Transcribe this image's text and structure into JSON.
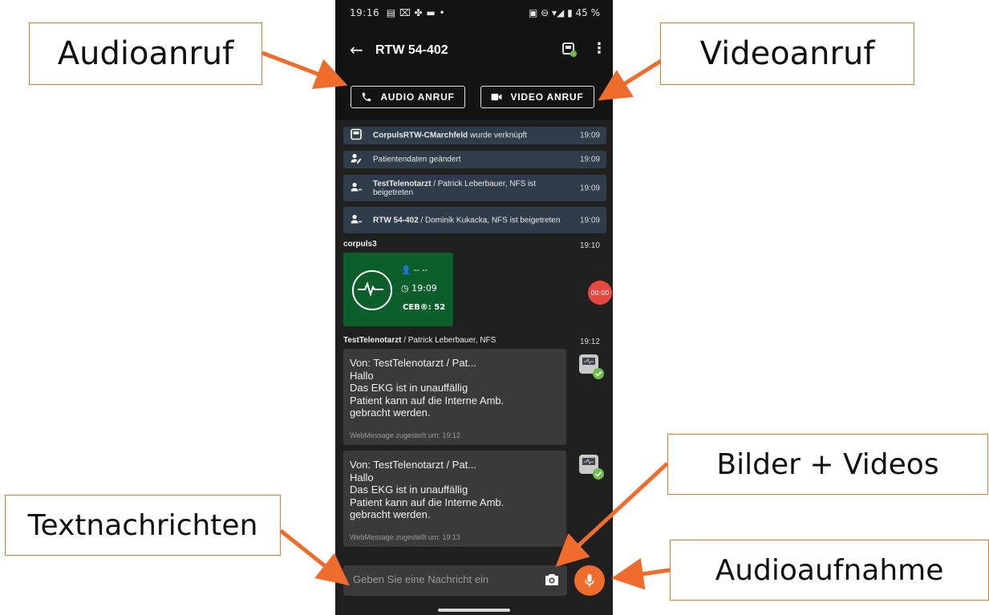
{
  "status_bar": {
    "time": "19:16",
    "battery": "45 %"
  },
  "header": {
    "title": "RTW 54-402"
  },
  "call_buttons": {
    "audio_label": "AUDIO ANRUF",
    "video_label": "VIDEO ANRUF"
  },
  "system_messages": [
    {
      "bold": "CorpulsRTW-CMarchfeld",
      "text": " wurde verknüpft",
      "time": "19:09"
    },
    {
      "bold": "",
      "text": "Patientendaten geändert",
      "time": "19:09"
    },
    {
      "bold": "TestTelenotarzt",
      "text": " / Patrick Leberbauer, NFS ist beigetreten",
      "time": "19:09"
    },
    {
      "bold": "RTW 54-402",
      "text": " / Dominik Kukacka, NFS ist beigetreten",
      "time": "19:09"
    }
  ],
  "ecg_message": {
    "sender": "corpuls3",
    "time": "19:10",
    "patient": "-- --",
    "clock": "19:09",
    "ceb": "CEB®: 52"
  },
  "recording_badge": "00:00",
  "text_messages_header": {
    "sender_bold": "TestTelenotarzt",
    "sender_rest": " / Patrick Leberbauer, NFS",
    "time": "19:12"
  },
  "text_messages": [
    {
      "body": "Von: TestTelenotarzt / Pat...\nHallo\nDas EKG ist in unauffällig\nPatient kann auf die Interne Amb.\ngebracht werden.",
      "footer": "WebMessage zugestellt um: 19:12"
    },
    {
      "body": "Von: TestTelenotarzt / Pat...\nHallo\nDas EKG ist in unauffällig\nPatient kann auf die Interne Amb.\ngebracht werden.",
      "footer": "WebMessage zugestellt um: 19:13"
    }
  ],
  "input": {
    "placeholder": "Geben Sie eine Nachricht ein"
  },
  "callouts": {
    "audio_call": "Audioanruf",
    "video_call": "Videoanruf",
    "media": "Bilder + Videos",
    "text_messages": "Textnachrichten",
    "audio_recording": "Audioaufnahme"
  },
  "colors": {
    "accent": "#ef6c2c",
    "callout_border": "#e87722",
    "system_bg": "#2f3d4a",
    "ecg_bg": "#0c5f2a",
    "rec": "#e8473f"
  }
}
